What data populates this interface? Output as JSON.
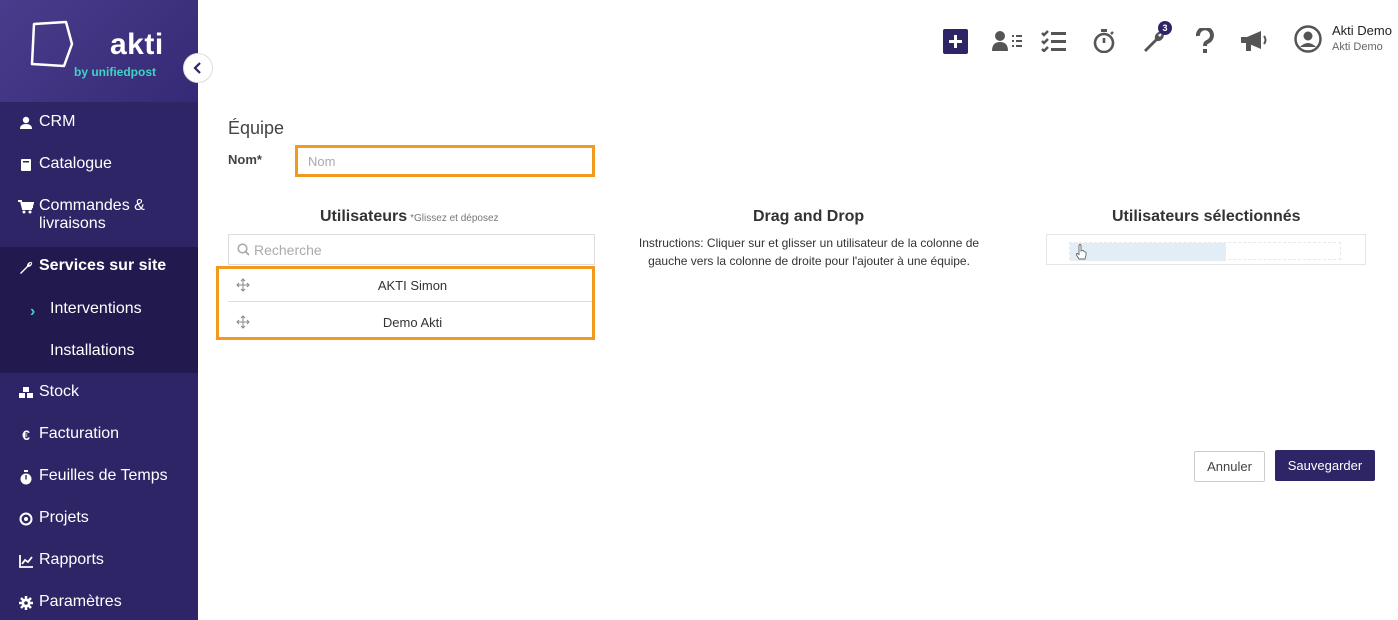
{
  "brand": {
    "name": "akti",
    "tagline": "by unifiedpost",
    "accent": "#3fd4c4",
    "primary": "#2e2566"
  },
  "sidebar": {
    "items": [
      {
        "label": "CRM",
        "icon": "user-icon"
      },
      {
        "label": "Catalogue",
        "icon": "book-icon"
      },
      {
        "label": "Commandes & livraisons",
        "icon": "cart-icon"
      },
      {
        "label": "Services sur site",
        "icon": "wrench-icon",
        "active": true
      },
      {
        "label": "Stock",
        "icon": "cubes-icon"
      },
      {
        "label": "Facturation",
        "icon": "euro-icon"
      },
      {
        "label": "Feuilles de Temps",
        "icon": "stopwatch-icon"
      },
      {
        "label": "Projets",
        "icon": "target-icon"
      },
      {
        "label": "Rapports",
        "icon": "chart-icon"
      },
      {
        "label": "Paramètres",
        "icon": "gear-icon"
      }
    ],
    "subitems": [
      {
        "label": "Interventions",
        "active": true
      },
      {
        "label": "Installations"
      }
    ]
  },
  "topbar": {
    "notifications_count": "3",
    "user_name": "Akti Demo",
    "user_company": "Akti Demo"
  },
  "form": {
    "title": "Équipe",
    "name_label": "Nom*",
    "name_placeholder": "Nom",
    "users_header": "Utilisateurs",
    "users_hint": "*Glissez et déposez",
    "search_placeholder": "Recherche",
    "users": [
      "AKTI Simon",
      "Demo Akti"
    ],
    "dnd_header": "Drag and Drop",
    "dnd_instructions": "Instructions: Cliquer sur et glisser un utilisateur de la colonne de gauche vers la colonne de droite pour l'ajouter à une équipe.",
    "selected_header": "Utilisateurs sélectionnés",
    "cancel_label": "Annuler",
    "save_label": "Sauvegarder"
  }
}
